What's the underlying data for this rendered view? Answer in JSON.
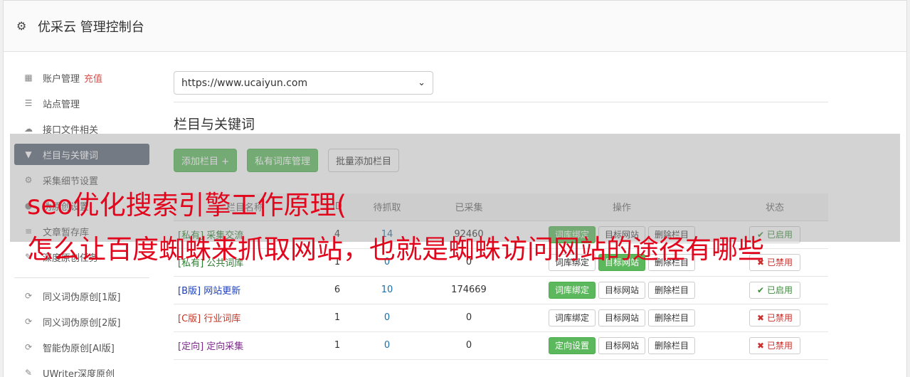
{
  "app": {
    "title": "优采云 管理控制台",
    "icon": "gear-icon"
  },
  "sidebar": {
    "items": [
      {
        "label": "账户管理",
        "badge": "充值",
        "icon": "bar-chart-icon"
      },
      {
        "label": "站点管理",
        "icon": "server-icon"
      },
      {
        "label": "接口文件相关",
        "icon": "cloud-upload-icon"
      },
      {
        "label": "栏目与关键词",
        "icon": "filter-icon",
        "active": true
      },
      {
        "label": "采集细节设置",
        "icon": "cogs-icon"
      },
      {
        "label": "伪原创设置",
        "icon": "globe-icon"
      },
      {
        "label": "文章暂存库",
        "icon": "database-icon"
      },
      {
        "label": "深度原创任务",
        "icon": "edit-icon"
      }
    ],
    "tools": [
      {
        "label": "同义词伪原创[1版]",
        "icon": "refresh-icon"
      },
      {
        "label": "同义词伪原创[2版]",
        "icon": "refresh-icon"
      },
      {
        "label": "智能伪原创[AI版]",
        "icon": "refresh-icon"
      },
      {
        "label": "UWriter深度原创",
        "icon": "edit-icon"
      }
    ]
  },
  "main": {
    "site_select": "https://www.ucaiyun.com",
    "section_title": "栏目与关键词",
    "buttons": {
      "add": "添加栏目 +",
      "private": "私有词库管理",
      "batch": "批量添加栏目"
    },
    "columns": [
      "栏目名称",
      "ID",
      "待抓取",
      "已采集",
      "操作",
      "状态"
    ],
    "rows": [
      {
        "tag": "[私有]",
        "name": "采集交流",
        "id": "4",
        "pending": "14",
        "collected": "92460",
        "op1": "词库绑定",
        "op1_green": true,
        "op2": "目标网站",
        "op2_green": false,
        "op3": "删除栏目",
        "status": "已启用",
        "on": true,
        "cls": "tag-private"
      },
      {
        "tag": "[私有]",
        "name": "公共词库",
        "id": "1",
        "pending": "0",
        "collected": "0",
        "op1": "词库绑定",
        "op1_green": false,
        "op2": "目标网站",
        "op2_green": true,
        "op3": "删除栏目",
        "status": "已禁用",
        "on": false,
        "cls": "tag-private"
      },
      {
        "tag": "[B版]",
        "name": "网站更新",
        "id": "6",
        "pending": "10",
        "collected": "174669",
        "op1": "词库绑定",
        "op1_green": true,
        "op2": "目标网站",
        "op2_green": false,
        "op3": "删除栏目",
        "status": "已启用",
        "on": true,
        "cls": "tag-b"
      },
      {
        "tag": "[C版]",
        "name": "行业词库",
        "id": "1",
        "pending": "0",
        "collected": "0",
        "op1": "词库绑定",
        "op1_green": false,
        "op2": "目标网站",
        "op2_green": false,
        "op3": "删除栏目",
        "status": "已禁用",
        "on": false,
        "cls": "tag-c"
      },
      {
        "tag": "[定向]",
        "name": "定向采集",
        "id": "1",
        "pending": "0",
        "collected": "0",
        "op1": "定向设置",
        "op1_green": true,
        "op2": "目标网站",
        "op2_green": false,
        "op3": "删除栏目",
        "status": "已禁用",
        "on": false,
        "cls": "tag-dir"
      }
    ]
  },
  "overlay": {
    "line1": "seo优化搜索引擎工作原理(",
    "line2": "怎么让百度蜘蛛来抓取网站，也就是蜘蛛访问网站的途径有哪些"
  }
}
